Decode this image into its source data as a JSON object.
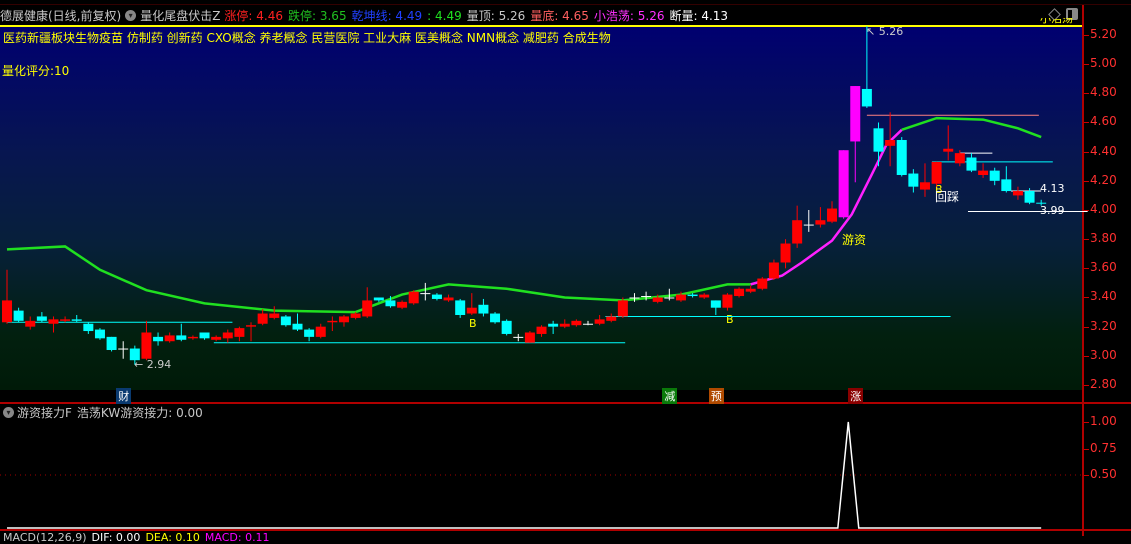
{
  "header": {
    "stock": "德展健康(日线,前复权)",
    "indicator": "量化尾盘伏击Z",
    "fields": [
      {
        "label": "涨停: 4.46",
        "color": "#ff2020"
      },
      {
        "label": "跌停: 3.65",
        "color": "#20c020"
      },
      {
        "label": "乾坤线: 4.49",
        "color": "#2040ff"
      },
      {
        "label": ": 4.49",
        "color": "#20e020"
      },
      {
        "label": "量顶: 5.26",
        "color": "#c8c8c8"
      },
      {
        "label": "量底: 4.65",
        "color": "#ff6060"
      },
      {
        "label": "小浩荡: 5.26",
        "color": "#ff30ff"
      },
      {
        "label": "断量: 4.13",
        "color": "#ffffff"
      }
    ]
  },
  "concepts": "医药新疆板块生物疫苗 仿制药 创新药 CXO概念 养老概念 民营医院 工业大麻 医美概念 NMN概念 减肥药 合成生物",
  "score": "量化评分:10",
  "corner_label": "小浩荡",
  "annotations": {
    "low": "2.94",
    "high": "5.26",
    "last_high": "4.13",
    "last_low": "3.99",
    "b1": "B",
    "b2": "B",
    "b3": "B",
    "pullback": "回踩",
    "hot_money": "游资"
  },
  "markers": [
    {
      "text": "财",
      "bg": "#0a3a70",
      "index": 10
    },
    {
      "text": "减",
      "bg": "#0a7a0a",
      "index": 57
    },
    {
      "text": "预",
      "bg": "#b04a00",
      "index": 61
    },
    {
      "text": "涨",
      "bg": "#8a0000",
      "index": 73
    }
  ],
  "sub_panel": {
    "title": "游资接力F",
    "value_label": "浩荡KW游资接力: 0.00"
  },
  "macd_row": {
    "name": "MACD(12,26,9)",
    "dif": "DIF: 0.00",
    "dea": "DEA: 0.10",
    "macd": "MACD: 0.11"
  },
  "colors": {
    "up": "#ff0000",
    "down": "#00ffff",
    "limit": "#ff00ff",
    "ma_long": "#20e020",
    "ma_short": "#ff20ff"
  },
  "chart_data": [
    {
      "type": "candlestick",
      "y_ticks": [
        "5.20",
        "5.00",
        "4.80",
        "4.60",
        "4.40",
        "4.20",
        "4.00",
        "3.80",
        "3.60",
        "3.40",
        "3.20",
        "3.00",
        "2.80"
      ],
      "ylim": [
        2.8,
        5.2
      ],
      "candles": [
        [
          3.23,
          3.38,
          3.59,
          3.22
        ],
        [
          3.31,
          3.24,
          3.33,
          3.23
        ],
        [
          3.2,
          3.24,
          3.27,
          3.18
        ],
        [
          3.27,
          3.24,
          3.3,
          3.23
        ],
        [
          3.22,
          3.25,
          3.27,
          3.16
        ],
        [
          3.24,
          3.25,
          3.27,
          3.23
        ],
        [
          3.25,
          3.24,
          3.28,
          3.23
        ],
        [
          3.22,
          3.17,
          3.23,
          3.15
        ],
        [
          3.18,
          3.12,
          3.19,
          3.11
        ],
        [
          3.13,
          3.04,
          3.13,
          3.03
        ],
        [
          3.05,
          3.05,
          3.1,
          2.98
        ],
        [
          3.05,
          2.97,
          3.07,
          2.94
        ],
        [
          2.98,
          3.16,
          3.24,
          2.97
        ],
        [
          3.13,
          3.1,
          3.16,
          3.07
        ],
        [
          3.1,
          3.14,
          3.16,
          3.09
        ],
        [
          3.14,
          3.11,
          3.22,
          3.1
        ],
        [
          3.12,
          3.13,
          3.14,
          3.11
        ],
        [
          3.16,
          3.12,
          3.16,
          3.11
        ],
        [
          3.11,
          3.13,
          3.14,
          3.1
        ],
        [
          3.12,
          3.16,
          3.18,
          3.09
        ],
        [
          3.13,
          3.19,
          3.2,
          3.1
        ],
        [
          3.2,
          3.21,
          3.23,
          3.1
        ],
        [
          3.22,
          3.29,
          3.32,
          3.21
        ],
        [
          3.26,
          3.29,
          3.34,
          3.25
        ],
        [
          3.27,
          3.21,
          3.28,
          3.2
        ],
        [
          3.22,
          3.18,
          3.29,
          3.17
        ],
        [
          3.18,
          3.13,
          3.19,
          3.1
        ],
        [
          3.13,
          3.2,
          3.22,
          3.12
        ],
        [
          3.23,
          3.24,
          3.27,
          3.17
        ],
        [
          3.23,
          3.27,
          3.28,
          3.2
        ],
        [
          3.26,
          3.29,
          3.3,
          3.25
        ],
        [
          3.27,
          3.38,
          3.47,
          3.26
        ],
        [
          3.4,
          3.38,
          3.4,
          3.37
        ],
        [
          3.38,
          3.34,
          3.41,
          3.33
        ],
        [
          3.33,
          3.37,
          3.38,
          3.32
        ],
        [
          3.36,
          3.44,
          3.45,
          3.35
        ],
        [
          3.43,
          3.43,
          3.5,
          3.38
        ],
        [
          3.42,
          3.39,
          3.43,
          3.38
        ],
        [
          3.38,
          3.4,
          3.42,
          3.37
        ],
        [
          3.38,
          3.28,
          3.39,
          3.26
        ],
        [
          3.29,
          3.33,
          3.43,
          3.28
        ],
        [
          3.35,
          3.29,
          3.39,
          3.27
        ],
        [
          3.29,
          3.23,
          3.3,
          3.22
        ],
        [
          3.24,
          3.15,
          3.25,
          3.14
        ],
        [
          3.13,
          3.13,
          3.15,
          3.1
        ],
        [
          3.09,
          3.16,
          3.17,
          3.09
        ],
        [
          3.15,
          3.2,
          3.21,
          3.13
        ],
        [
          3.22,
          3.2,
          3.24,
          3.15
        ],
        [
          3.2,
          3.22,
          3.25,
          3.19
        ],
        [
          3.21,
          3.24,
          3.25,
          3.2
        ],
        [
          3.22,
          3.22,
          3.24,
          3.21
        ],
        [
          3.22,
          3.25,
          3.28,
          3.21
        ],
        [
          3.24,
          3.27,
          3.29,
          3.23
        ],
        [
          3.27,
          3.38,
          3.4,
          3.26
        ],
        [
          3.4,
          3.4,
          3.43,
          3.37
        ],
        [
          3.41,
          3.41,
          3.44,
          3.38
        ],
        [
          3.37,
          3.4,
          3.42,
          3.36
        ],
        [
          3.4,
          3.4,
          3.46,
          3.38
        ],
        [
          3.38,
          3.42,
          3.44,
          3.37
        ],
        [
          3.42,
          3.41,
          3.43,
          3.4
        ],
        [
          3.4,
          3.42,
          3.43,
          3.39
        ],
        [
          3.38,
          3.33,
          3.38,
          3.28
        ],
        [
          3.33,
          3.42,
          3.43,
          3.31
        ],
        [
          3.41,
          3.46,
          3.47,
          3.4
        ],
        [
          3.44,
          3.46,
          3.48,
          3.43
        ],
        [
          3.46,
          3.53,
          3.54,
          3.45
        ],
        [
          3.53,
          3.64,
          3.66,
          3.52
        ],
        [
          3.64,
          3.77,
          3.8,
          3.6
        ],
        [
          3.77,
          3.93,
          4.03,
          3.74
        ],
        [
          3.9,
          3.9,
          4.0,
          3.85
        ],
        [
          3.9,
          3.93,
          4.02,
          3.88
        ],
        [
          3.92,
          4.01,
          4.06,
          3.91
        ],
        [
          3.95,
          4.41,
          4.41,
          3.94
        ],
        [
          4.47,
          4.85,
          4.85,
          4.19
        ],
        [
          4.83,
          4.71,
          5.26,
          4.7
        ],
        [
          4.56,
          4.4,
          4.6,
          4.3
        ],
        [
          4.44,
          4.48,
          4.67,
          4.3
        ],
        [
          4.48,
          4.24,
          4.5,
          4.23
        ],
        [
          4.25,
          4.16,
          4.28,
          4.12
        ],
        [
          4.14,
          4.19,
          4.32,
          4.09
        ],
        [
          4.18,
          4.33,
          4.33,
          4.16
        ],
        [
          4.4,
          4.42,
          4.58,
          4.34
        ],
        [
          4.32,
          4.39,
          4.41,
          4.3
        ],
        [
          4.36,
          4.27,
          4.39,
          4.26
        ],
        [
          4.24,
          4.27,
          4.32,
          4.22
        ],
        [
          4.27,
          4.2,
          4.29,
          4.17
        ],
        [
          4.21,
          4.13,
          4.3,
          4.12
        ],
        [
          4.1,
          4.13,
          4.16,
          4.07
        ],
        [
          4.13,
          4.05,
          4.15,
          4.04
        ],
        [
          4.05,
          4.05,
          4.07,
          4.03
        ]
      ],
      "limit_up_indices": [
        72,
        73
      ],
      "ma_long": [
        [
          0,
          3.73
        ],
        [
          5,
          3.75
        ],
        [
          8,
          3.59
        ],
        [
          12,
          3.45
        ],
        [
          17,
          3.36
        ],
        [
          23,
          3.31
        ],
        [
          30,
          3.3
        ],
        [
          34,
          3.42
        ],
        [
          38,
          3.49
        ],
        [
          43,
          3.46
        ],
        [
          48,
          3.4
        ],
        [
          53,
          3.38
        ],
        [
          58,
          3.42
        ],
        [
          62,
          3.49
        ],
        [
          64,
          3.49
        ]
      ],
      "ma_long_2": [
        [
          77,
          4.55
        ],
        [
          80,
          4.63
        ],
        [
          84,
          4.62
        ],
        [
          87,
          4.56
        ],
        [
          89,
          4.5
        ]
      ],
      "ma_short": [
        [
          64,
          3.49
        ],
        [
          66.7,
          3.55
        ],
        [
          68.4,
          3.64
        ],
        [
          71,
          3.79
        ],
        [
          72.7,
          3.97
        ],
        [
          74.4,
          4.24
        ],
        [
          75.7,
          4.45
        ],
        [
          77,
          4.55
        ]
      ],
      "levels": [
        {
          "price": 3.23,
          "from": 0,
          "to": 19.4,
          "color": "#00ffff"
        },
        {
          "price": 3.09,
          "from": 17.8,
          "to": 53.2,
          "color": "#00ffff"
        },
        {
          "price": 3.27,
          "from": 51.5,
          "to": 81.2,
          "color": "#00ffff"
        },
        {
          "price": 4.65,
          "from": 74,
          "to": 88.8,
          "color": "#ff8080"
        },
        {
          "price": 4.33,
          "from": 79.6,
          "to": 90,
          "color": "#00ffff"
        },
        {
          "price": 4.39,
          "from": 82,
          "to": 84.8,
          "color": "#ffffff"
        },
        {
          "price": 3.99,
          "from": 82.7,
          "to": 93,
          "color": "#ffffff"
        },
        {
          "price": 4.13,
          "from": 86.4,
          "to": 89,
          "color": "#ffffff"
        }
      ]
    },
    {
      "type": "line",
      "title": "游资接力F",
      "y_ticks": [
        "1.00",
        "0.75",
        "0.50"
      ],
      "ylim": [
        0,
        1.05
      ],
      "series": [
        {
          "name": "浩荡KW游资接力",
          "points": [
            [
              0,
              0
            ],
            [
              71.5,
              0
            ],
            [
              72.4,
              1.0
            ],
            [
              73.3,
              0
            ],
            [
              89,
              0
            ]
          ]
        }
      ]
    }
  ]
}
